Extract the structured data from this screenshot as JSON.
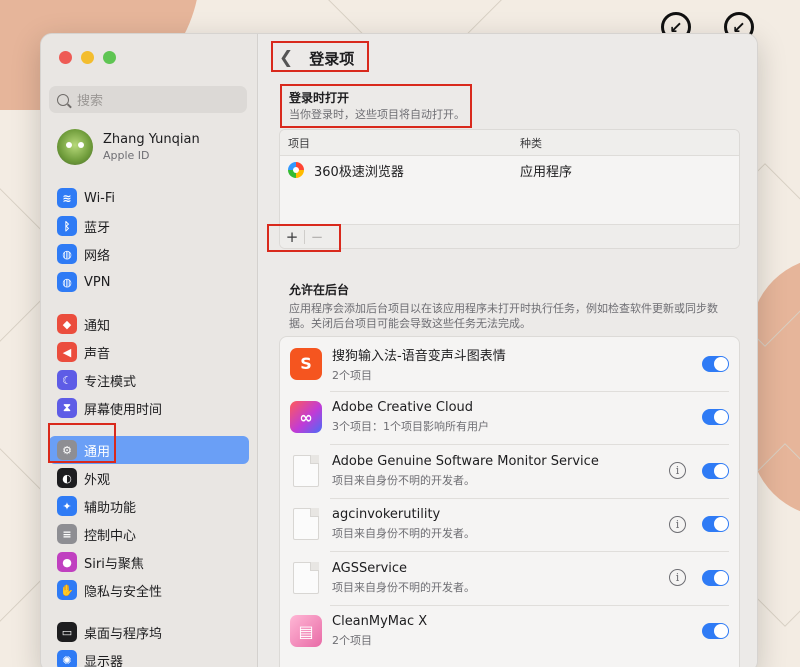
{
  "sidebar": {
    "search_placeholder": "搜索",
    "account": {
      "name": "Zhang Yunqian",
      "subtitle": "Apple ID"
    },
    "groups": [
      [
        {
          "label": "Wi-Fi",
          "icon": "wifi-icon",
          "color": "#2f7bf5"
        },
        {
          "label": "蓝牙",
          "icon": "bluetooth-icon",
          "color": "#2f7bf5"
        },
        {
          "label": "网络",
          "icon": "globe-icon",
          "color": "#2f7bf5"
        },
        {
          "label": "VPN",
          "icon": "vpn-icon",
          "color": "#2f7bf5"
        }
      ],
      [
        {
          "label": "通知",
          "icon": "bell-icon",
          "color": "#eb4d3d"
        },
        {
          "label": "声音",
          "icon": "speaker-icon",
          "color": "#eb4d3d"
        },
        {
          "label": "专注模式",
          "icon": "moon-icon",
          "color": "#5e5ce6"
        },
        {
          "label": "屏幕使用时间",
          "icon": "hourglass-icon",
          "color": "#5e5ce6"
        }
      ],
      [
        {
          "label": "通用",
          "icon": "gear-icon",
          "color": "#8e8e93",
          "active": true
        },
        {
          "label": "外观",
          "icon": "appearance-icon",
          "color": "#1d1d1f"
        },
        {
          "label": "辅助功能",
          "icon": "accessibility-icon",
          "color": "#2f7bf5"
        },
        {
          "label": "控制中心",
          "icon": "control-center-icon",
          "color": "#8e8e93"
        },
        {
          "label": "Siri与聚焦",
          "icon": "siri-icon",
          "color": "#c040c0"
        },
        {
          "label": "隐私与安全性",
          "icon": "hand-icon",
          "color": "#2f7bf5"
        }
      ],
      [
        {
          "label": "桌面与程序坞",
          "icon": "dock-icon",
          "color": "#1d1d1f"
        },
        {
          "label": "显示器",
          "icon": "display-icon",
          "color": "#2f7bf5"
        }
      ]
    ]
  },
  "main": {
    "title": "登录项",
    "login_section": {
      "title": "登录时打开",
      "description": "当你登录时，这些项目将自动打开。",
      "columns": [
        "项目",
        "种类"
      ],
      "rows": [
        {
          "name": "360极速浏览器",
          "kind": "应用程序"
        }
      ],
      "add_label": "+",
      "remove_label": "−"
    },
    "background_section": {
      "title": "允许在后台",
      "description": "应用程序会添加后台项目以在该应用程序未打开时执行任务，例如检查软件更新或同步数据。关闭后台项目可能会导致这些任务无法完成。",
      "items": [
        {
          "name": "搜狗输入法-语音变声斗图表情",
          "sub": "2个项目",
          "icon": "sogou-icon",
          "info": false,
          "enabled": true
        },
        {
          "name": "Adobe Creative Cloud",
          "sub": "3个项目：1个项目影响所有用户",
          "icon": "creative-cloud-icon",
          "info": false,
          "enabled": true
        },
        {
          "name": "Adobe Genuine Software Monitor Service",
          "sub": "项目来自身份不明的开发者。",
          "icon": "document-icon",
          "info": true,
          "enabled": true
        },
        {
          "name": "agcinvokerutility",
          "sub": "项目来自身份不明的开发者。",
          "icon": "document-icon",
          "info": true,
          "enabled": true
        },
        {
          "name": "AGSService",
          "sub": "项目来自身份不明的开发者。",
          "icon": "document-icon",
          "info": true,
          "enabled": true
        },
        {
          "name": "CleanMyMac X",
          "sub": "2个项目",
          "icon": "cleanmymac-icon",
          "info": false,
          "enabled": true
        }
      ]
    }
  }
}
